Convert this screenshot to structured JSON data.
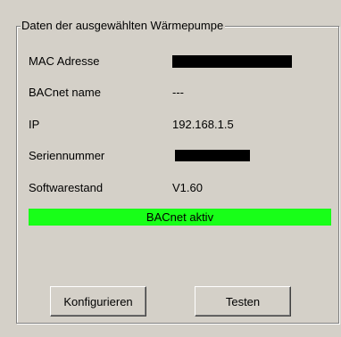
{
  "group": {
    "title": "Daten der ausgewählten Wärmepumpe"
  },
  "fields": {
    "mac": {
      "label": "MAC Adresse",
      "value": ""
    },
    "bacnet_name": {
      "label": "BACnet name",
      "value": "---"
    },
    "ip": {
      "label": "IP",
      "value": "192.168.1.5"
    },
    "serial": {
      "label": "Seriennummer",
      "value": ""
    },
    "software": {
      "label": "Softwarestand",
      "value": "V1.60"
    }
  },
  "status": {
    "text": "BACnet aktiv",
    "color": "#18ff18"
  },
  "buttons": {
    "configure": "Konfigurieren",
    "test": "Testen"
  }
}
